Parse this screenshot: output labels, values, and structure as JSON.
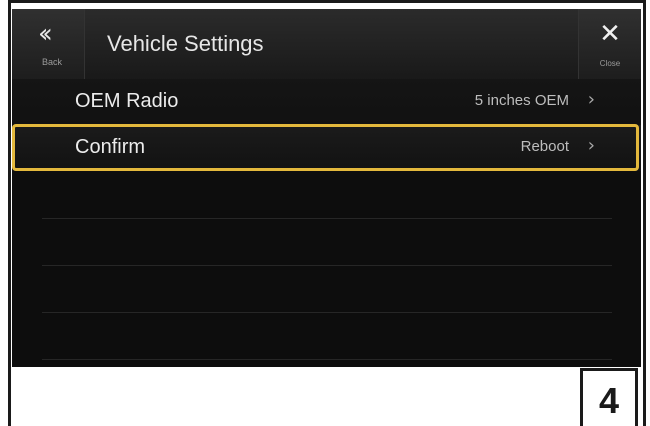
{
  "header": {
    "back_label": "Back",
    "title": "Vehicle Settings",
    "close_label": "Close"
  },
  "rows": [
    {
      "label": "OEM Radio",
      "value": "5 inches OEM",
      "selected": false
    },
    {
      "label": "Confirm",
      "value": "Reboot",
      "selected": true
    }
  ],
  "step_number": "4",
  "colors": {
    "highlight": "#e3b83c",
    "screen_background": "#0d0d0d",
    "text": "#ececec"
  },
  "icons": {
    "back": "double-chevron-left-icon",
    "close": "close-x-icon",
    "row_arrow": "chevron-right-icon"
  }
}
